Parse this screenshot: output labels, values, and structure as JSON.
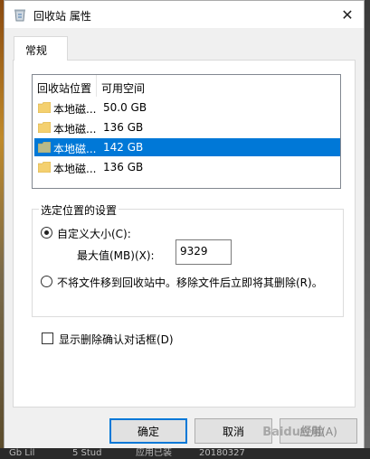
{
  "window": {
    "title": "回收站 属性"
  },
  "tabs": [
    {
      "label": "常规"
    }
  ],
  "list": {
    "columns": [
      "回收站位置",
      "可用空间"
    ],
    "rows": [
      {
        "name": "本地磁...",
        "size": "50.0 GB",
        "selected": false
      },
      {
        "name": "本地磁...",
        "size": "136 GB",
        "selected": false
      },
      {
        "name": "本地磁...",
        "size": "142 GB",
        "selected": true
      },
      {
        "name": "本地磁...",
        "size": "136 GB",
        "selected": false
      }
    ]
  },
  "settings": {
    "group_label": "选定位置的设置",
    "custom_size_label": "自定义大小(C):",
    "max_label": "最大值(MB)(X):",
    "max_value": "9329",
    "no_move_label": "不将文件移到回收站中。移除文件后立即将其删除(R)。"
  },
  "confirm_dialog_label": "显示删除确认对话框(D)",
  "buttons": {
    "ok": "确定",
    "cancel": "取消",
    "apply": "应用(A)"
  },
  "watermark": "Baidu经验",
  "taskbar": [
    "Gb Lil",
    "5 Stud",
    "应用已装",
    "20180327"
  ],
  "colors": {
    "selection": "#0078d7",
    "folder": "#f4d06f"
  }
}
